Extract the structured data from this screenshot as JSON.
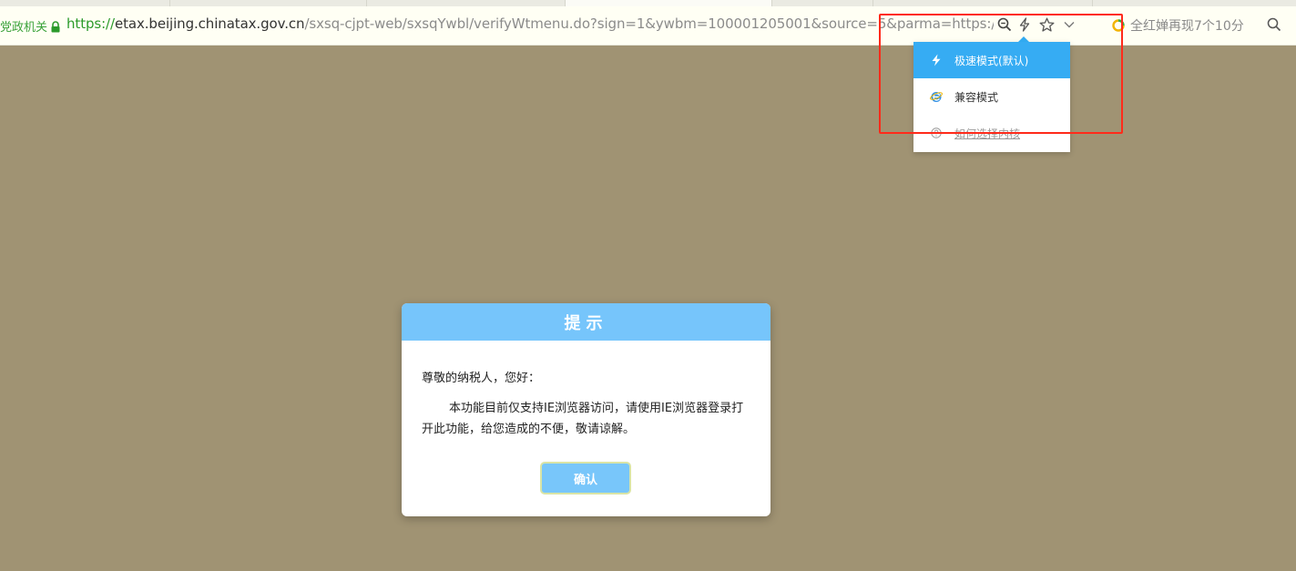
{
  "browser": {
    "ev_label": "党政机关",
    "url": {
      "scheme": "https://",
      "host": "etax.beijing.chinatax.gov.cn",
      "path": "/sxsq-cjpt-web/sxsqYwbl/verifyWtmenu.do?sign=1&ywbm=100001205001&source=5&parma=https://etax.beijing.chi"
    },
    "news_ticker": "全红婵再现7个10分",
    "icons": {
      "lock": "lock-icon",
      "zoom": "zoom-icon",
      "kernel_switch": "lightning-icon",
      "favorite": "star-icon",
      "dropdown": "chevron-down-icon",
      "news": "news-dot-icon",
      "search": "search-icon"
    }
  },
  "kernel_menu": {
    "items": [
      {
        "label": "极速模式(默认)",
        "icon": "lightning-icon",
        "selected": true
      },
      {
        "label": "兼容模式",
        "icon": "ie-icon",
        "selected": false
      },
      {
        "label": "如何选择内核",
        "icon": "help-circle-icon",
        "selected": false
      }
    ]
  },
  "dialog": {
    "title": "提示",
    "greeting": "尊敬的纳税人，您好：",
    "message": "本功能目前仅支持IE浏览器访问，请使用IE浏览器登录打开此功能，给您造成的不便，敬请谅解。",
    "confirm_label": "确认"
  },
  "colors": {
    "page_background": "#a09373",
    "dialog_header": "#76c5fb",
    "menu_selected": "#36acf3",
    "highlight_box": "#ff2a1a",
    "url_scheme": "#2b9a2b"
  }
}
